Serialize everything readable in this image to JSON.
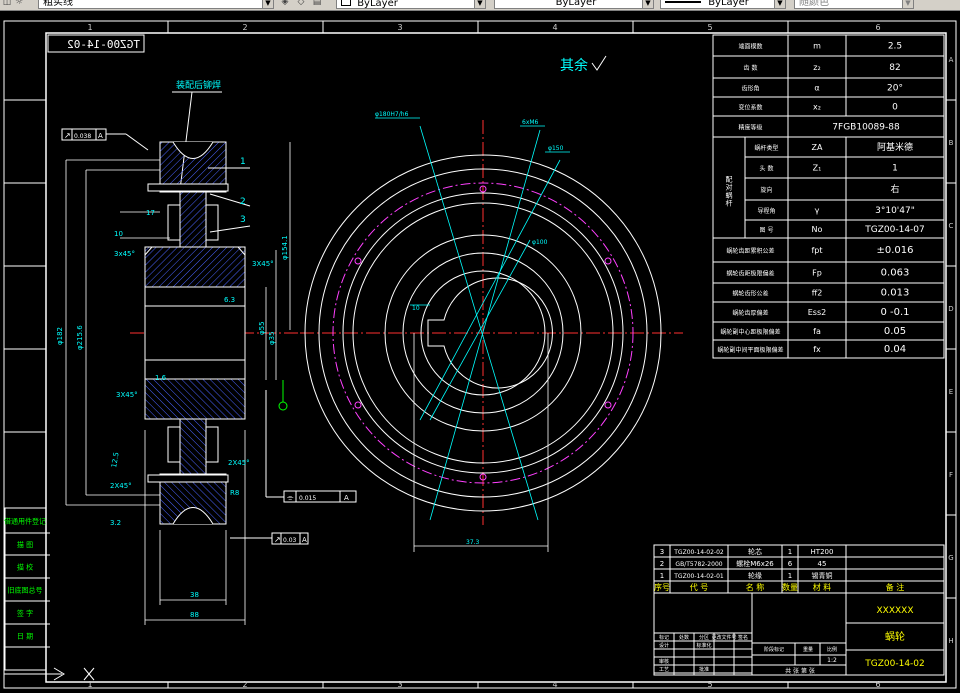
{
  "toolbar": {
    "linetype_value": "粗实线",
    "color_value": "ByLayer",
    "linetype2_value": "ByLayer",
    "lineweight_value": "ByLayer",
    "plotstyle_value": "随颜色"
  },
  "frame": {
    "col_numbers": [
      "1",
      "2",
      "3",
      "4",
      "5",
      "6"
    ],
    "row_letters": [
      "A",
      "B",
      "C",
      "D",
      "E",
      "F",
      "G",
      "H"
    ],
    "mirrored_code": "TGZ00-14-02"
  },
  "notes": {
    "surface_roughness": "其余",
    "weld_note": "装配后铆焊"
  },
  "callouts": [
    "1",
    "2",
    "3"
  ],
  "dims": {
    "d_pitch": "φ182",
    "d_outer": "φ215.6",
    "d_hub": "φ55",
    "d_bore": "φ35",
    "d_rim": "φ154.1",
    "d_right": "φ144.7",
    "cham1": "3x45°",
    "cham2": "3X45°",
    "cham3": "2X45°",
    "cham4": "2X45°",
    "w1": "17",
    "w2": "10",
    "w_bottom1": "38",
    "w_bottom2": "88",
    "r_small": "R8",
    "angle1": "1.6",
    "angle2": "12.5",
    "rough1": "3.2",
    "rough2": "6.3",
    "view_d1": "φ180H7/h6",
    "view_bolt": "6xM6",
    "view_d2": "φ150",
    "view_d3": "φ100",
    "view_key": "10",
    "view_width": "37.3"
  },
  "gdt": {
    "top": {
      "sym": "↗",
      "val": "0.038",
      "ref": "A"
    },
    "mid": {
      "sym": "⌯",
      "val": "0.015",
      "ref": "A"
    },
    "bot": {
      "sym": "↗",
      "val": "0.03",
      "ref": "A"
    }
  },
  "param_table": [
    [
      "端面模数",
      "m",
      "2.5"
    ],
    [
      "齿 数",
      "z₂",
      "82"
    ],
    [
      "齿形角",
      "α",
      "20°"
    ],
    [
      "变位系数",
      "x₂",
      "0"
    ],
    [
      "精度等级",
      "",
      "7FGB10089-88"
    ],
    [
      "蜗杆类型",
      "ZA",
      "阿基米德"
    ],
    [
      "头 数",
      "Z₁",
      "1"
    ],
    [
      "旋向",
      "",
      "右"
    ],
    [
      "导程角",
      "γ",
      "3°10'47\""
    ],
    [
      "图 号",
      "No",
      "TGZ00-14-07"
    ],
    [
      "蜗轮齿距累积公差",
      "fpt",
      "±0.016"
    ],
    [
      "蜗轮齿距极限偏差",
      "Fp",
      "0.063"
    ],
    [
      "蜗轮齿形公差",
      "ff2",
      "0.013"
    ],
    [
      "蜗轮齿厚偏差",
      "Ess2",
      "0 -0.1"
    ],
    [
      "蜗轮副中心距极限偏差",
      "fa",
      "0.05"
    ],
    [
      "蜗轮副中间平面极限偏差",
      "fx",
      "0.04"
    ]
  ],
  "param_group_label": "配对蜗杆",
  "bom": [
    [
      "3",
      "TGZ00-14-02-02",
      "轮芯",
      "1",
      "HT200",
      ""
    ],
    [
      "2",
      "GB/T5782-2000",
      "螺栓M6x26",
      "6",
      "45",
      ""
    ],
    [
      "1",
      "TGZ00-14-02-01",
      "轮缘",
      "1",
      "锡青铜",
      ""
    ]
  ],
  "bom_header": [
    "序号",
    "代 号",
    "名 称",
    "数量",
    "材 料",
    "备 注"
  ],
  "title_block": {
    "company": "XXXXXX",
    "part_name": "蜗轮",
    "drawing_no": "TGZ00-14-02",
    "scale": "1:2",
    "sheets_label": "共 张 第 张",
    "labels": [
      "标记",
      "处数",
      "分区",
      "更改文件号",
      "签名",
      "年月日",
      "设计",
      "标准化",
      "审核",
      "工艺",
      "批准",
      "阶段标记",
      "重量",
      "比例"
    ]
  },
  "left_stamp": [
    "借通用件登记",
    "描 图",
    "描 校",
    "旧底图总号",
    "签 字",
    "日 期"
  ]
}
